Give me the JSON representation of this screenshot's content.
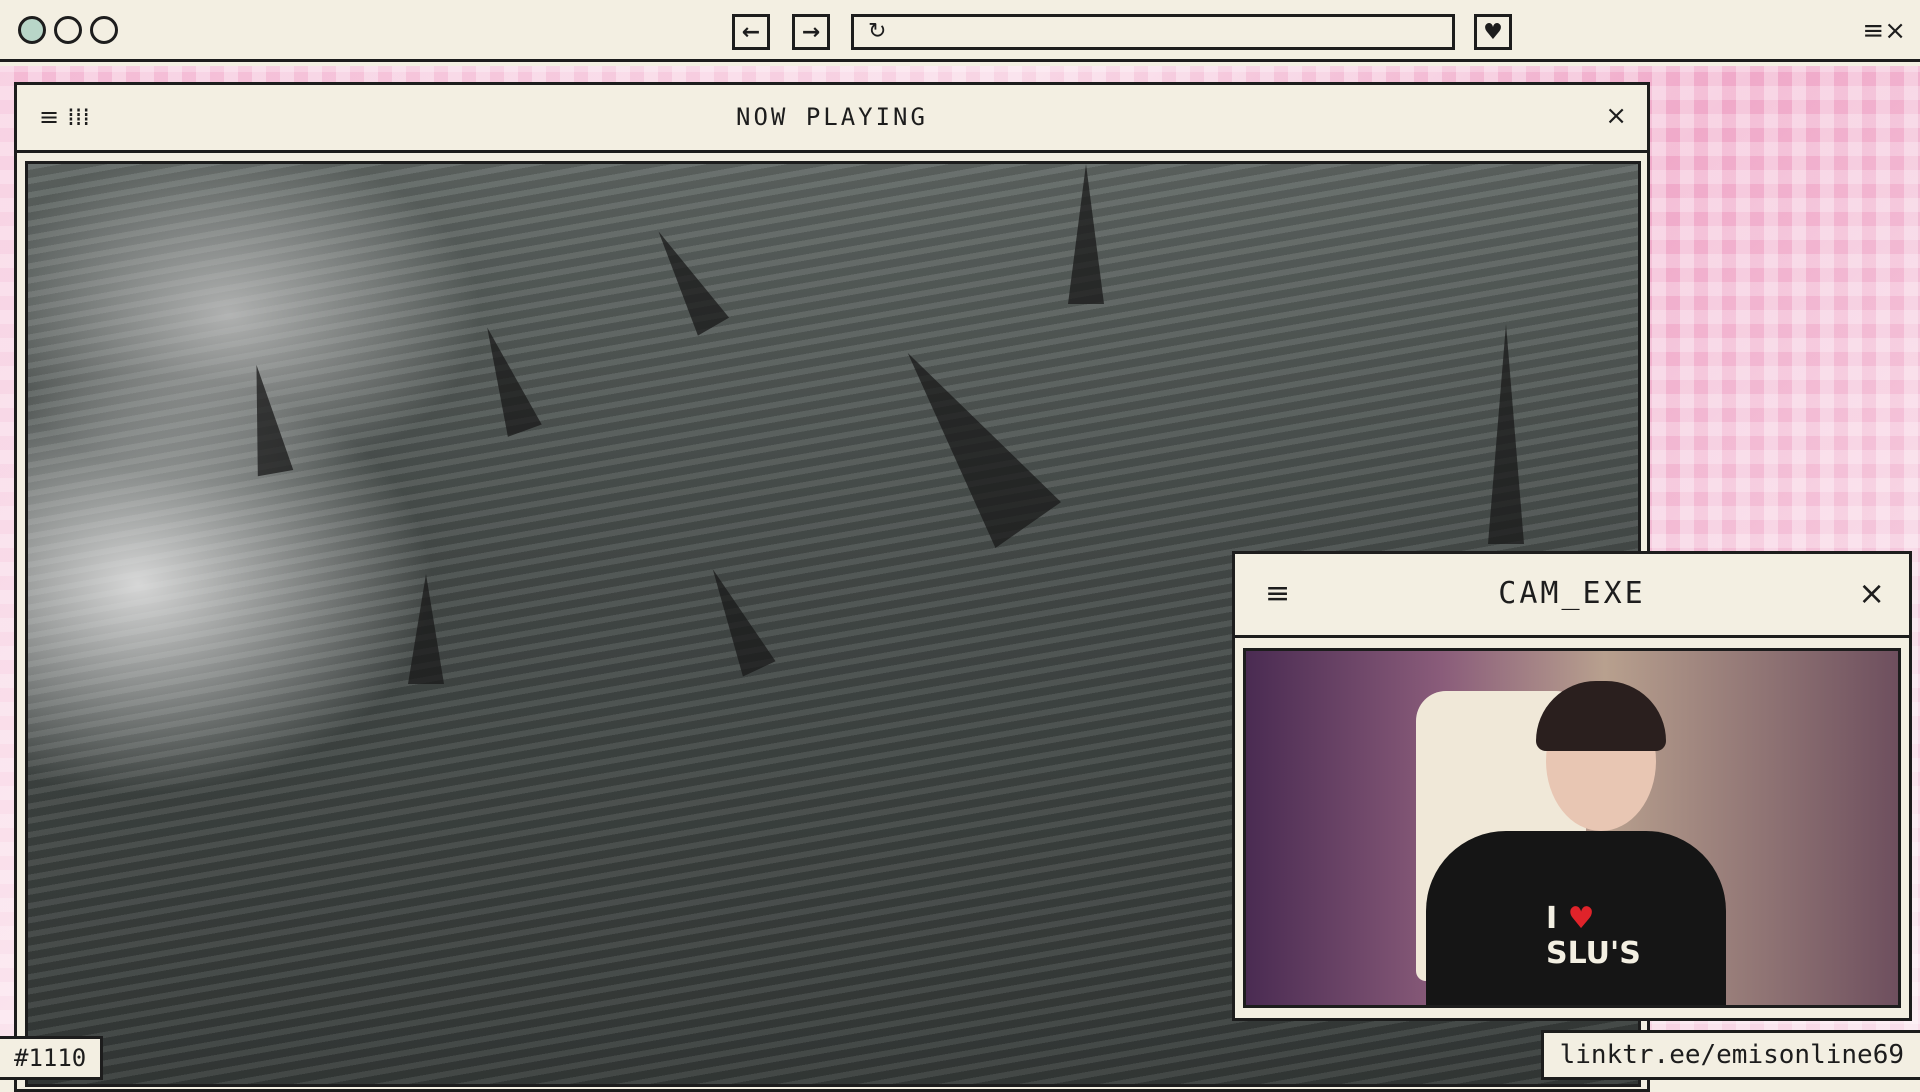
{
  "browser": {
    "back_icon": "arrow-left-icon",
    "back_glyph": "←",
    "forward_icon": "arrow-right-icon",
    "forward_glyph": "→",
    "reload_icon": "reload-icon",
    "reload_glyph": "↻",
    "favorite_icon": "heart-icon",
    "favorite_glyph": "♥",
    "menu_close_glyph": "≡×"
  },
  "now_playing": {
    "title": "NOW PLAYING",
    "menu_glyph": "≡",
    "grid_glyph": "⁞⁞⁞",
    "close_glyph": "×"
  },
  "cam": {
    "title": "CAM_EXE",
    "menu_glyph": "≡",
    "close_glyph": "×",
    "shirt_line1": "I",
    "shirt_heart": "♥",
    "shirt_line2": "SLU'S"
  },
  "footer": {
    "episode": "#1110",
    "link": "linktr.ee/emisonline69"
  },
  "colors": {
    "ink": "#1d1d1d",
    "paper": "#f3efe2",
    "blossom": "#f4b9d4",
    "heart": "#e0232a"
  }
}
